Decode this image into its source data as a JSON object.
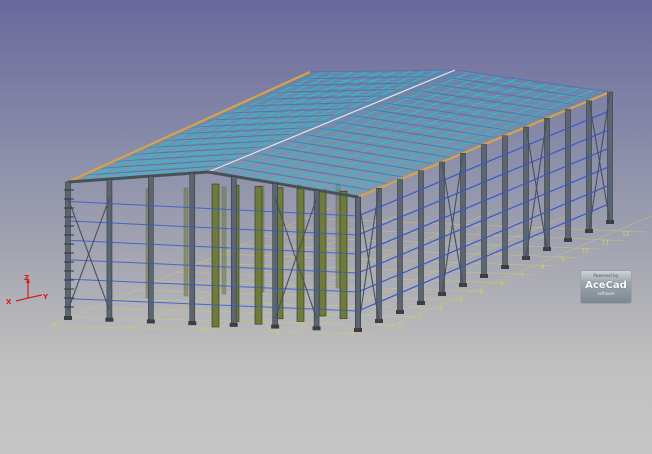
{
  "viewport": {
    "background_top": "#6a689c",
    "background_bottom": "#c6c6c6"
  },
  "colors": {
    "roof_purlins": "#27c4cf",
    "rafters": "#5a6fb0",
    "eave_beam": "#d8a24a",
    "columns": "#6e7b3a",
    "column_edge": "#2c3418",
    "side_girts": "#3a58c8",
    "bracing": "#47505a",
    "grid_lines": "#d8d060",
    "axis_x": "#d02020",
    "axis_y": "#d02020",
    "axis_z": "#d02020"
  },
  "axis_triad": {
    "x_label": "X",
    "y_label": "Y",
    "z_label": "Z"
  },
  "grid_labels": {
    "front_row": [
      "0",
      "1",
      "2",
      "3",
      "4"
    ],
    "right_row": [
      "1",
      "2",
      "3",
      "4",
      "5",
      "6",
      "7",
      "8",
      "9",
      "10",
      "11",
      "12"
    ]
  },
  "logo": {
    "top_text": "Powered by",
    "name": "AceCad",
    "sub_text": "software"
  }
}
